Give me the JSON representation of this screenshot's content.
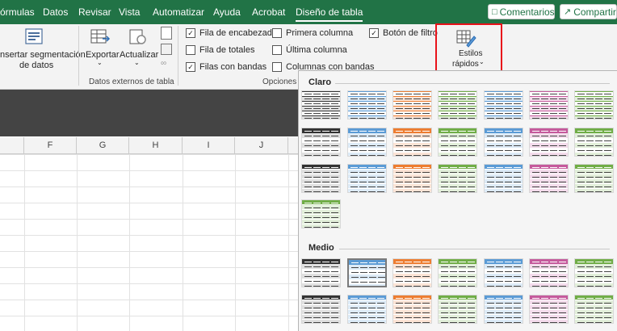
{
  "tabs": [
    "órmulas",
    "Datos",
    "Revisar",
    "Vista",
    "Automatizar",
    "Ayuda",
    "Acrobat",
    "Diseño de tabla"
  ],
  "buttons": {
    "comments": "Comentarios",
    "share": "Compartir"
  },
  "ribbon": {
    "insert_slicer": [
      "nsertar segmentación",
      "de datos"
    ],
    "export": "Exportar",
    "refresh": "Actualizar",
    "external_group": "Datos externos de tabla",
    "options_group": "Opciones",
    "options": [
      {
        "label": "Fila de encabezado",
        "checked": true
      },
      {
        "label": "Fila de totales",
        "checked": false
      },
      {
        "label": "Filas con bandas",
        "checked": true
      },
      {
        "label": "Primera columna",
        "checked": false
      },
      {
        "label": "Última columna",
        "checked": false
      },
      {
        "label": "Columnas con bandas",
        "checked": false
      },
      {
        "label": "Botón de filtro",
        "checked": true
      }
    ],
    "quick_styles": [
      "Estilos",
      "rápidos"
    ]
  },
  "columns": [
    "F",
    "G",
    "H",
    "I",
    "J"
  ],
  "gallery": {
    "light": "Claro",
    "medium": "Medio"
  },
  "colors": {
    "ribbon_green": "#217346",
    "highlight": "#e8121a",
    "palette": [
      "#333333",
      "#5b9bd5",
      "#ed7d31",
      "#a5a5a5",
      "#ffc000",
      "#4472c4",
      "#70ad47",
      "#c55a9c"
    ]
  }
}
